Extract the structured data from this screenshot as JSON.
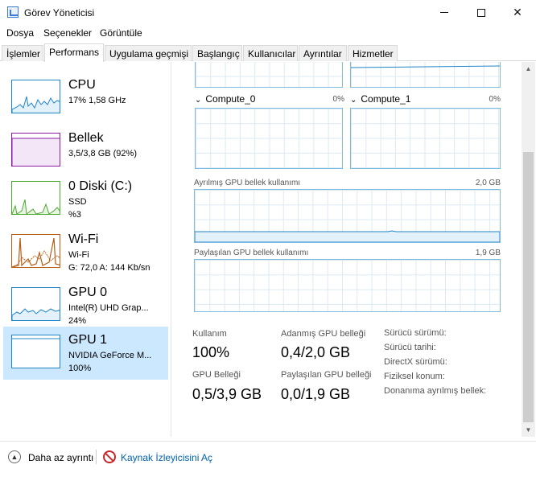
{
  "window": {
    "title": "Görev Yöneticisi",
    "minimize_icon": "minimize-icon",
    "maximize_icon": "maximize-icon",
    "close_glyph": "✕"
  },
  "menu": [
    "Dosya",
    "Seçenekler",
    "Görüntüle"
  ],
  "tabs": [
    {
      "label": "İşlemler",
      "active": false
    },
    {
      "label": "Performans",
      "active": true
    },
    {
      "label": "Uygulama geçmişi",
      "active": false
    },
    {
      "label": "Başlangıç",
      "active": false
    },
    {
      "label": "Kullanıcılar",
      "active": false
    },
    {
      "label": "Ayrıntılar",
      "active": false
    },
    {
      "label": "Hizmetler",
      "active": false
    }
  ],
  "resources": [
    {
      "name": "CPU",
      "line1": "17% 1,58 GHz",
      "line2": "",
      "line3": "",
      "color": "#1f84c7"
    },
    {
      "name": "Bellek",
      "line1": "3,5/3,8 GB (92%)",
      "line2": "",
      "line3": "",
      "color": "#8b1aa5"
    },
    {
      "name": "0 Diski (C:)",
      "line1": "SSD",
      "line2": "%3",
      "line3": "",
      "color": "#4da82f"
    },
    {
      "name": "Wi-Fi",
      "line1": "Wi-Fi",
      "line2": "G: 72,0  A: 144 Kb/sn",
      "line3": "",
      "color": "#b75d14"
    },
    {
      "name": "GPU 0",
      "line1": "Intel(R) UHD Grap...",
      "line2": "24%",
      "line3": "",
      "color": "#1f84c7"
    },
    {
      "name": "GPU 1",
      "line1": "NVIDIA GeForce M...",
      "line2": "100%",
      "line3": "",
      "color": "#1f84c7"
    }
  ],
  "engines": [
    {
      "label": "Compute_0",
      "pct": "0%"
    },
    {
      "label": "Compute_1",
      "pct": "0%"
    }
  ],
  "dedicated_graph": {
    "label": "Ayrılmış GPU bellek kullanımı",
    "max": "2,0 GB"
  },
  "shared_graph": {
    "label": "Paylaşılan GPU bellek kullanımı",
    "max": "1,9 GB"
  },
  "stats": {
    "utilization_label": "Kullanım",
    "utilization_value": "100%",
    "dedicated_label": "Adanmış GPU belleği",
    "dedicated_value": "0,4/2,0 GB",
    "gpu_memory_label": "GPU Belleği",
    "gpu_memory_value": "0,5/3,9 GB",
    "shared_label": "Paylaşılan GPU belleği",
    "shared_value": "0,0/1,9 GB"
  },
  "info_labels": [
    "Sürücü sürümü:",
    "Sürücü tarihi:",
    "DirectX sürümü:",
    "Fiziksel konum:",
    "Donanıma ayrılmış bellek:"
  ],
  "footer": {
    "fewer_details": "Daha az ayrıntı",
    "resource_monitor": "Kaynak İzleyicisini Aç"
  }
}
